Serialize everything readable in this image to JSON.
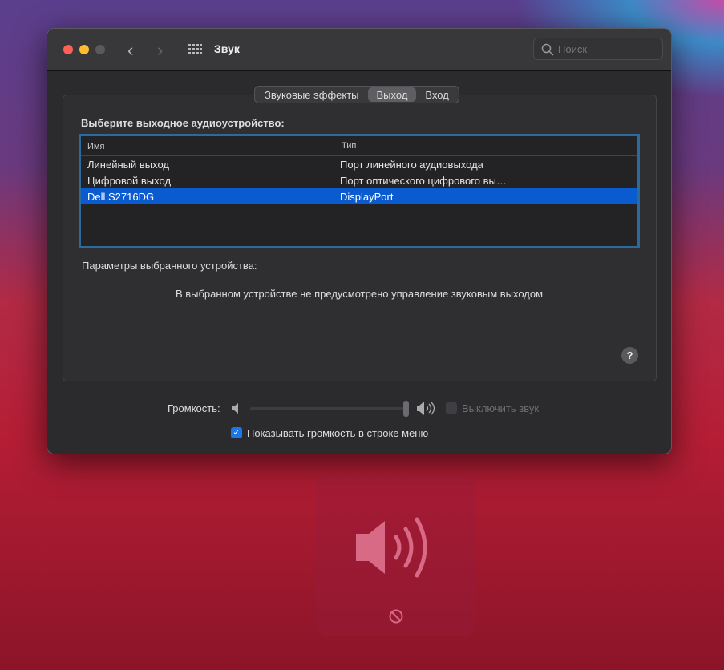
{
  "window": {
    "title": "Звук",
    "search_placeholder": "Поиск"
  },
  "tabs": [
    {
      "label": "Звуковые эффекты",
      "active": false
    },
    {
      "label": "Выход",
      "active": true
    },
    {
      "label": "Вход",
      "active": false
    }
  ],
  "output": {
    "heading": "Выберите выходное аудиоустройство:",
    "columns": [
      "Имя",
      "Тип"
    ],
    "rows": [
      {
        "name": "Линейный выход",
        "type": "Порт линейного аудиовыхода",
        "selected": false
      },
      {
        "name": "Цифровой выход",
        "type": "Порт оптического цифрового вы…",
        "selected": false
      },
      {
        "name": "Dell S2716DG",
        "type": "DisplayPort",
        "selected": true
      }
    ],
    "params_label": "Параметры выбранного устройства:",
    "no_control_msg": "В выбранном устройстве не предусмотрено управление звуковым выходом",
    "help": "?"
  },
  "volume": {
    "label": "Громкость:",
    "level": 1.0,
    "mute_label": "Выключить звук",
    "mute_checked": false,
    "show_in_menu_label": "Показывать громкость в строке меню",
    "show_in_menu_checked": true
  },
  "colors": {
    "accent": "#0a5ad0",
    "close": "#ff5f57",
    "minimize": "#febc2e"
  }
}
